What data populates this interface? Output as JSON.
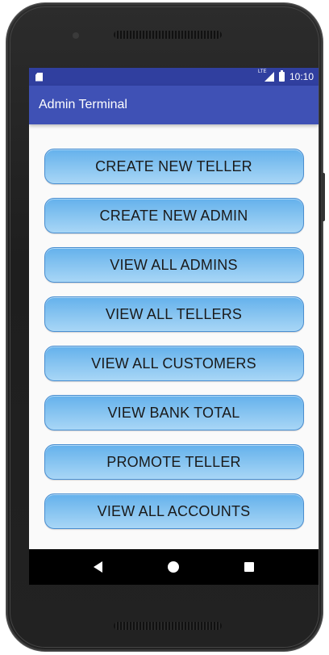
{
  "status_bar": {
    "time": "10:10",
    "network": "LTE",
    "icons": [
      "sd-card-icon",
      "signal-icon",
      "battery-icon"
    ]
  },
  "app_bar": {
    "title": "Admin Terminal"
  },
  "menu": {
    "buttons": [
      {
        "label": "CREATE NEW TELLER"
      },
      {
        "label": "CREATE NEW ADMIN"
      },
      {
        "label": "VIEW ALL ADMINS"
      },
      {
        "label": "VIEW ALL TELLERS"
      },
      {
        "label": "VIEW ALL CUSTOMERS"
      },
      {
        "label": "VIEW BANK TOTAL"
      },
      {
        "label": "PROMOTE TELLER"
      },
      {
        "label": "VIEW ALL ACCOUNTS"
      }
    ]
  },
  "nav_bar": {
    "icons": [
      "back-icon",
      "home-icon",
      "recents-icon"
    ]
  },
  "colors": {
    "status_bar": "#303f9f",
    "app_bar": "#3f51b5",
    "button_top": "#64b1ec",
    "button_bottom": "#a8d6f6",
    "background": "#fafafa"
  }
}
